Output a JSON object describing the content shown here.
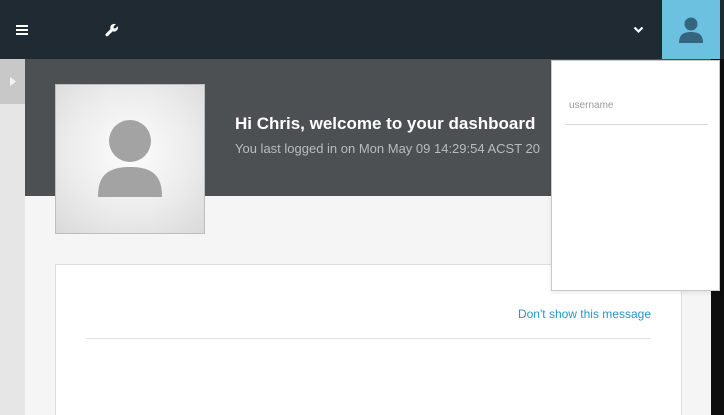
{
  "topbar": {
    "menu_icon": "hamburger-menu-icon",
    "tools_icon": "wrench-icon",
    "dropdown_icon": "chevron-down-icon",
    "user_icon": "user-silhouette-icon",
    "colors": {
      "bar": "#1f2a33",
      "user_button": "#6cc0e0"
    }
  },
  "sidebar": {
    "toggle_icon": "caret-right-icon"
  },
  "hero": {
    "greeting": "Hi Chris, welcome to your dashboard",
    "last_login": "You last logged in on Mon May 09 14:29:54 ACST 20",
    "avatar_icon": "user-silhouette-icon",
    "background": "#4d5052"
  },
  "card": {
    "dont_show_link": "Don't show this message",
    "link_color": "#2a94c4"
  },
  "user_dropdown": {
    "username_placeholder": "username",
    "username_value": ""
  }
}
